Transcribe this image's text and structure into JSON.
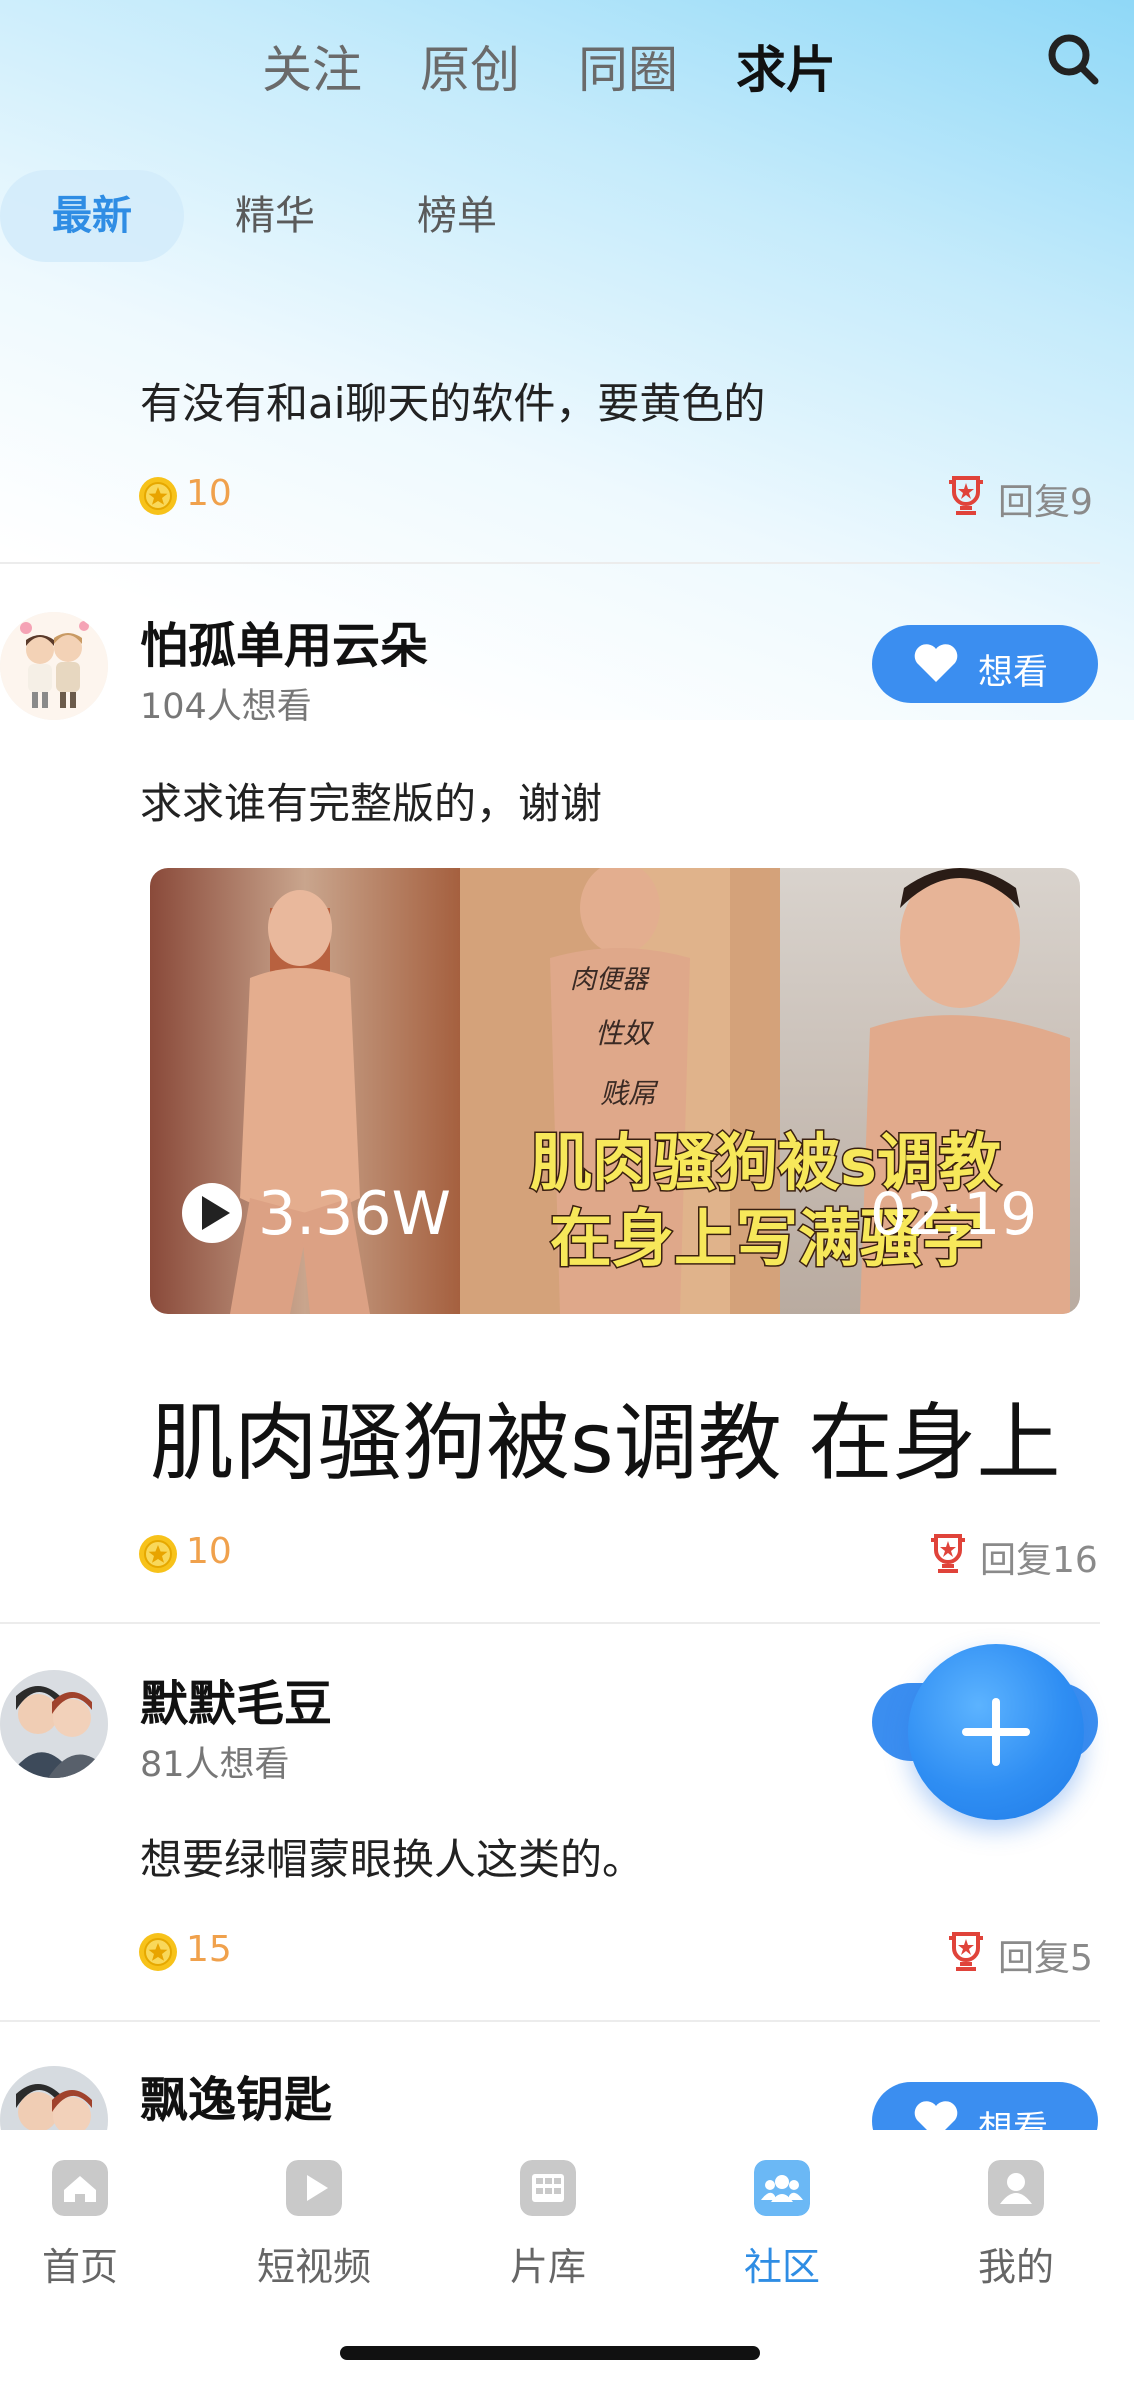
{
  "top_tabs": [
    "关注",
    "原创",
    "同圈",
    "求片"
  ],
  "sub_tabs": [
    "最新",
    "精华",
    "榜单"
  ],
  "posts": [
    {
      "text": "有没有和ai聊天的软件，要黄色的",
      "coins": "10",
      "reply": "回复9"
    },
    {
      "username": "怕孤单用云朵",
      "want_count": "104人想看",
      "want_label": "想看",
      "text": "求求谁有完整版的，谢谢",
      "video": {
        "plays": "3.36W",
        "duration": "02:19",
        "caption_line1": "肌肉骚狗被s调教",
        "caption_line2": "在身上写满骚字"
      },
      "video_title": "肌肉骚狗被s调教  在身上",
      "coins": "10",
      "reply": "回复16"
    },
    {
      "username": "默默毛豆",
      "want_count": "81人想看",
      "text": "想要绿帽蒙眼换人这类的。",
      "coins": "15",
      "reply": "回复5"
    },
    {
      "username": "飘逸钥匙",
      "want_label": "想看"
    }
  ],
  "tabbar": [
    {
      "label": "首页",
      "icon": "home-icon"
    },
    {
      "label": "短视频",
      "icon": "play-icon"
    },
    {
      "label": "片库",
      "icon": "library-icon"
    },
    {
      "label": "社区",
      "icon": "community-icon"
    },
    {
      "label": "我的",
      "icon": "profile-icon"
    }
  ],
  "colors": {
    "accent": "#2f8de4",
    "button": "#3b8ef0",
    "coin": "#f0a14c",
    "reply_icon": "#e0433a"
  }
}
